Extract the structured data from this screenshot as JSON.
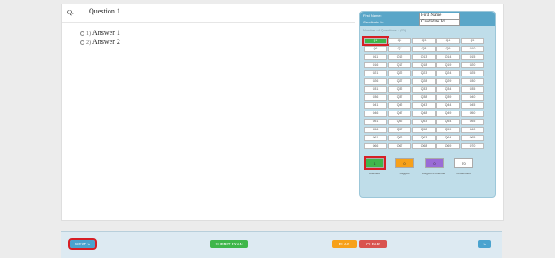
{
  "question": {
    "number_label": "Q.",
    "title": "Question 1",
    "answers": [
      {
        "letter": "1)",
        "text": "Answer 1"
      },
      {
        "letter": "2)",
        "text": "Answer 2"
      }
    ]
  },
  "palette": {
    "first_name_label": "First Name:",
    "first_name_value": "First Name",
    "candidate_id_label": "Candidate Id:",
    "candidate_id_value": "Candidate Id",
    "count_label": "Number of Questions : (70)",
    "cells": [
      "Q1",
      "Q2",
      "Q3",
      "Q4",
      "Q5",
      "Q6",
      "Q7",
      "Q8",
      "Q9",
      "Q10",
      "Q11",
      "Q12",
      "Q13",
      "Q14",
      "Q15",
      "Q16",
      "Q17",
      "Q18",
      "Q19",
      "Q20",
      "Q21",
      "Q22",
      "Q23",
      "Q24",
      "Q25",
      "Q26",
      "Q27",
      "Q28",
      "Q29",
      "Q30",
      "Q31",
      "Q32",
      "Q33",
      "Q34",
      "Q35",
      "Q36",
      "Q37",
      "Q38",
      "Q39",
      "Q40",
      "Q41",
      "Q42",
      "Q43",
      "Q44",
      "Q45",
      "Q46",
      "Q47",
      "Q48",
      "Q49",
      "Q50",
      "Q51",
      "Q52",
      "Q53",
      "Q54",
      "Q55",
      "Q56",
      "Q57",
      "Q58",
      "Q59",
      "Q60",
      "Q61",
      "Q62",
      "Q63",
      "Q64",
      "Q65",
      "Q66",
      "Q67",
      "Q68",
      "Q69",
      "Q70"
    ],
    "current_question_index": 0,
    "legend": [
      {
        "count": "1",
        "label": "Attended",
        "color": "#3fb64b"
      },
      {
        "count": "0",
        "label": "Flagged",
        "color": "#f7a11a"
      },
      {
        "count": "0",
        "label": "Flagged & Attended",
        "color": "#9a6bd6"
      },
      {
        "count": "70",
        "label": "Unattended",
        "color": "#ffffff"
      }
    ]
  },
  "footer": {
    "next_label": "NEXT »",
    "submit_label": "SUBMIT EXAM",
    "flag_label": "FLAG",
    "clear_label": "CLEAR",
    "last_label": "»"
  },
  "colors": {
    "next": "#4aa3cf",
    "submit": "#3fb64b",
    "flag": "#f7a11a",
    "clear": "#d9534f",
    "highlight": "#d61f26",
    "palette_header": "#5aa6c8"
  }
}
